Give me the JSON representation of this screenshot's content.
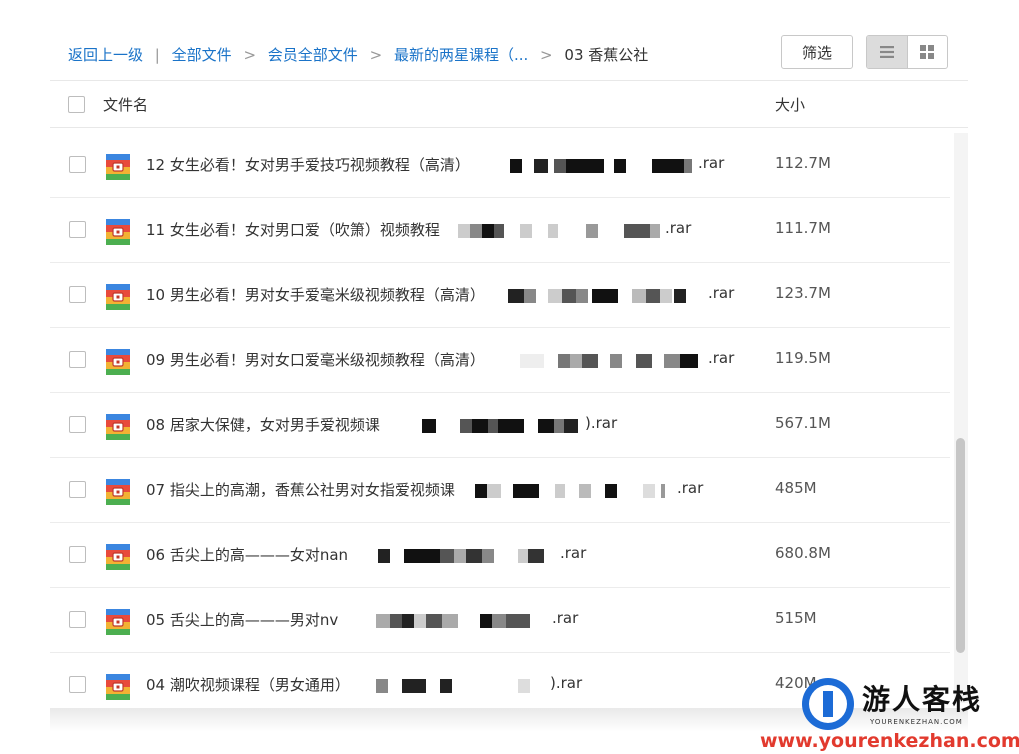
{
  "breadcrumb": {
    "items": [
      {
        "label": "返回上一级"
      },
      {
        "label": "全部文件"
      },
      {
        "label": "会员全部文件"
      },
      {
        "label": "最新的两星课程（..."
      }
    ],
    "current": "03 香蕉公社",
    "divider": "|",
    "arrow": ">"
  },
  "toolbar": {
    "filter_label": "筛选",
    "view_modes": [
      "list-icon",
      "grid-icon"
    ],
    "active_view": "list"
  },
  "table": {
    "headers": {
      "name": "文件名",
      "size": "大小"
    },
    "rows": [
      {
        "name": "12 女生必看！女对男手爱技巧视频教程（高清）",
        "ext": ".rar",
        "size": "112.7M"
      },
      {
        "name": "11 女生必看！女对男口爱（吹箫）视频教程",
        "ext": ".rar",
        "size": "111.7M"
      },
      {
        "name": "10 男生必看！男对女手爱毫米级视频教程（高清）",
        "ext": ".rar",
        "size": "123.7M"
      },
      {
        "name": "09 男生必看！男对女口爱毫米级视频教程（高清）",
        "ext": ".rar",
        "size": "119.5M"
      },
      {
        "name": "08 居家大保健，女对男手爱视频课",
        "ext": ").rar",
        "size": "567.1M"
      },
      {
        "name": "07 指尖上的高潮，香蕉公社男对女指爱视频课",
        "ext": ".rar",
        "size": "485M"
      },
      {
        "name": "06 舌尖上的高———女对nan",
        "ext": ".rar",
        "size": "680.8M"
      },
      {
        "name": "05 舌尖上的高———男对nv",
        "ext": ".rar",
        "size": "515M"
      },
      {
        "name": "04 潮吹视频课程（男女通用）",
        "ext": ").rar",
        "size": "420M"
      }
    ]
  },
  "watermark": {
    "title": "游人客栈",
    "subtitle": "YOURENKEZHAN.COM",
    "url": "www.yourenkezhan.com"
  },
  "colors": {
    "link": "#1a73c8",
    "border": "#c8c8c8",
    "watermark_blue": "#1c6bd6",
    "watermark_red": "#e23a2e"
  }
}
